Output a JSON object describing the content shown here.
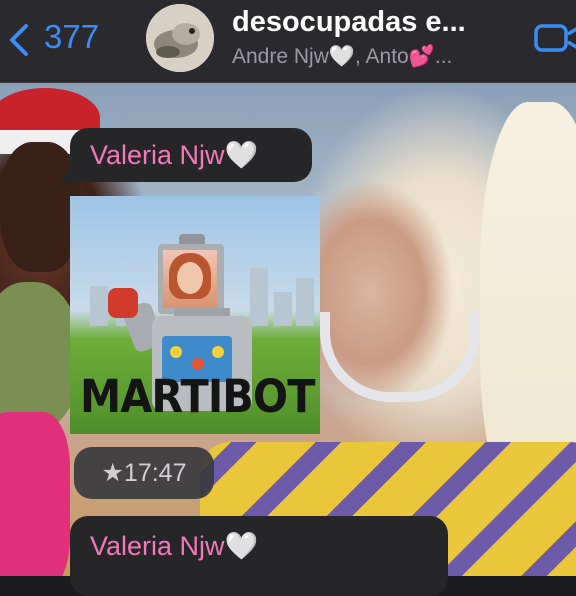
{
  "header": {
    "back_count": "377",
    "group_title": "desocupadas e...",
    "group_subtitle": "Andre Njw🤍, Anto💕..."
  },
  "messages": [
    {
      "sender": "Valeria Njw🤍",
      "type": "sticker",
      "sticker_text": "MARTIBOT",
      "time": "★17:47"
    },
    {
      "sender": "Valeria Njw🤍",
      "type": "text"
    }
  ],
  "colors": {
    "accent": "#3b8cf5",
    "sender_name": "#f279b8",
    "header_bg": "#2a2a2e",
    "bubble_bg": "#262628"
  },
  "icons": {
    "back": "chevron-left-icon",
    "video": "video-camera-icon",
    "star": "star-icon"
  }
}
